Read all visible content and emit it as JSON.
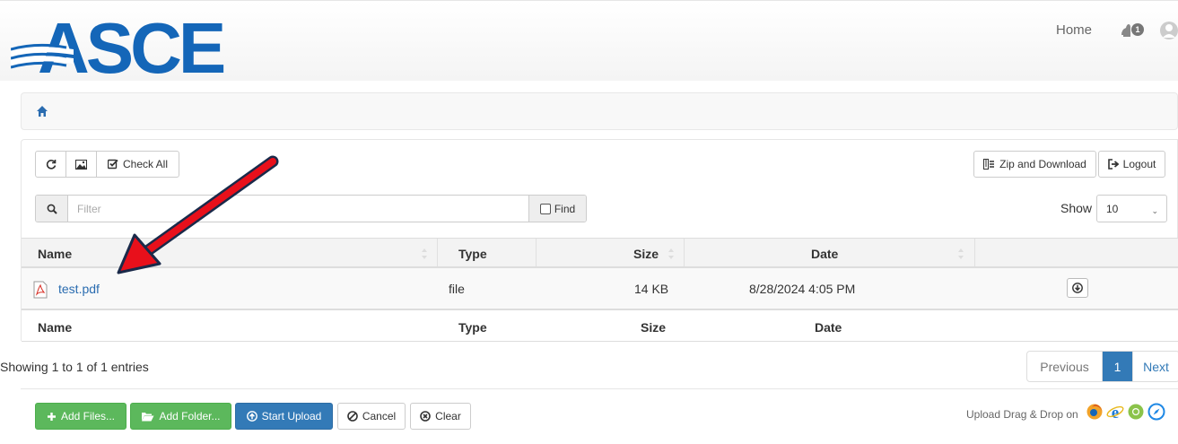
{
  "header": {
    "logo_text": "ASCE",
    "nav_home": "Home",
    "notification_count": "1"
  },
  "toolbar": {
    "refresh_icon": "refresh-icon",
    "image_icon": "image-icon",
    "check_all_label": "Check All",
    "zip_download_label": "Zip and Download",
    "logout_label": "Logout"
  },
  "filter": {
    "placeholder": "Filter",
    "find_label": "Find",
    "show_label": "Show",
    "show_value": "10"
  },
  "table": {
    "headers": [
      "Name",
      "Type",
      "Size",
      "Date"
    ],
    "footers": [
      "Name",
      "Type",
      "Size",
      "Date"
    ],
    "rows": [
      {
        "name": "test.pdf",
        "type": "file",
        "size": "14 KB",
        "date": "8/28/2024 4:05 PM",
        "icon": "pdf-icon"
      }
    ]
  },
  "info": {
    "showing": "Showing 1 to 1 of 1 entries"
  },
  "pagination": {
    "previous": "Previous",
    "current": "1",
    "next": "Next"
  },
  "upload": {
    "add_files": "Add Files...",
    "add_folder": "Add Folder...",
    "start_upload": "Start Upload",
    "cancel": "Cancel",
    "clear": "Clear",
    "drag_drop_text": "Upload Drag & Drop on"
  },
  "colors": {
    "brand_blue": "#1466b8",
    "link": "#2a6cb0",
    "primary": "#337ab7",
    "success": "#5cb85c",
    "arrow_red": "#e8101b",
    "arrow_outline": "#1a2a4a"
  }
}
